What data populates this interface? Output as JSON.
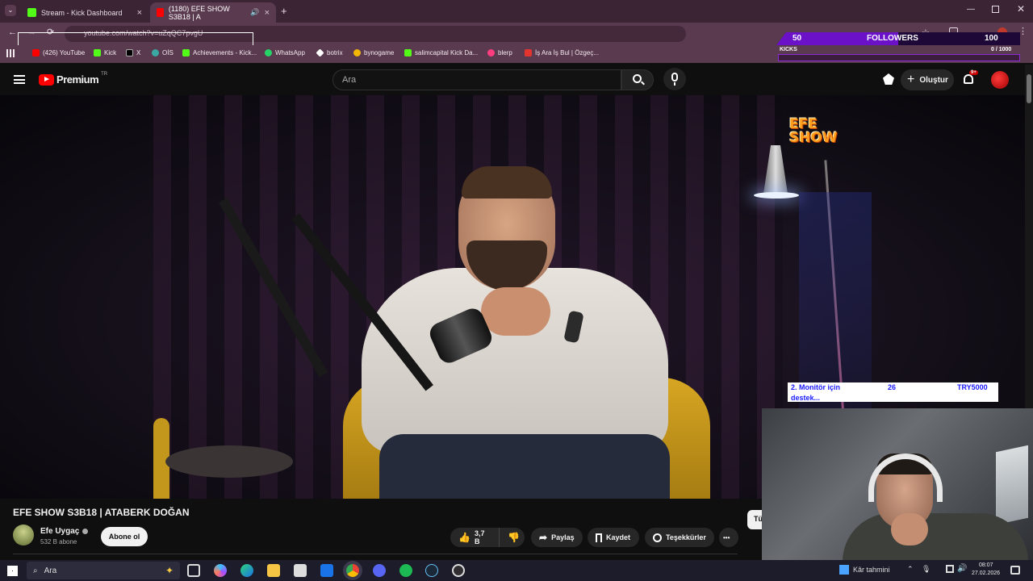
{
  "browser": {
    "tabs": [
      {
        "label": "Stream - Kick Dashboard",
        "color": "#53fc18"
      },
      {
        "label": "(1180) EFE SHOW S3B18 | A",
        "color": "#ff0000"
      }
    ],
    "new_tab": "+",
    "url": "youtube.com/watch?v=uZqQC7pvgU",
    "bookmarks": [
      {
        "label": "(426) YouTube",
        "color": "#ff0000"
      },
      {
        "label": "Kick",
        "color": "#53fc18"
      },
      {
        "label": "X",
        "color": "#000000"
      },
      {
        "label": "OİS",
        "color": "#3aa8a0"
      },
      {
        "label": "Achievements - Kick...",
        "color": "#53fc18"
      },
      {
        "label": "WhatsApp",
        "color": "#25d366"
      },
      {
        "label": "botrix",
        "color": "#ffffff"
      },
      {
        "label": "bynogame",
        "color": "#f2b705"
      },
      {
        "label": "salimcapital Kick Da...",
        "color": "#53fc18"
      },
      {
        "label": "blerp",
        "color": "#ff3d7f"
      },
      {
        "label": "İş Ara İş Bul | Özgeç...",
        "color": "#e3342f"
      }
    ]
  },
  "youtube": {
    "logo_text": "Premium",
    "region": "TR",
    "search_placeholder": "Ara",
    "create_label": "Oluştur",
    "notif_badge": "9+",
    "video_title": "EFE SHOW S3B18 | ATABERK DOĞAN",
    "channel_name": "Efe Uygaç",
    "subscribers": "532 B abone",
    "subscribe_label": "Abone ol",
    "like_count": "3,7 B",
    "share_label": "Paylaş",
    "save_label": "Kaydet",
    "thanks_label": "Teşekkürler",
    "more_label": "•••",
    "side_chip": "Tü",
    "show_logo_line1": "EFE",
    "show_logo_line2": "SHOW"
  },
  "stream_overlay": {
    "followers_current": "50",
    "followers_label": "FOLLOWERS",
    "followers_goal": "100",
    "followers_progress": 0.5,
    "kicks_label": "KICKS",
    "kicks_value": "0 / 1000",
    "donation_line1": "2. Monitör için",
    "donation_line2": "destek...",
    "donation_count": "26",
    "donation_amount": "TRY5000"
  },
  "taskbar": {
    "search_placeholder": "Ara",
    "weather_label": "Kâr tahmini",
    "time": "08:07",
    "date": "27.02.2026"
  }
}
